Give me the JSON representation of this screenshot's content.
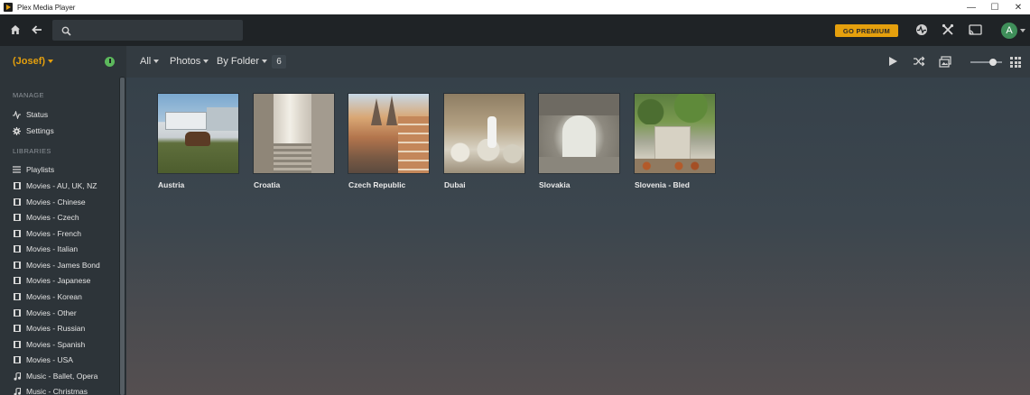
{
  "window": {
    "title": "Plex Media Player",
    "controls": [
      "—",
      "☐",
      "✕"
    ]
  },
  "topbar": {
    "search": {
      "placeholder": "",
      "value": ""
    },
    "premium_label": "GO PREMIUM",
    "avatar_letter": "A"
  },
  "subbar": {
    "user": "(Josef)",
    "filter_all": "All",
    "filter_type": "Photos",
    "filter_sort": "By Folder",
    "count": "6"
  },
  "sidebar": {
    "manage_header": "MANAGE",
    "manage": [
      {
        "label": "Status",
        "icon": "pulse-icon"
      },
      {
        "label": "Settings",
        "icon": "gear-icon"
      }
    ],
    "libraries_header": "LIBRARIES",
    "libraries": [
      {
        "label": "Playlists",
        "icon": "list-icon"
      },
      {
        "label": "Movies - AU, UK, NZ",
        "icon": "film-icon"
      },
      {
        "label": "Movies - Chinese",
        "icon": "film-icon"
      },
      {
        "label": "Movies - Czech",
        "icon": "film-icon"
      },
      {
        "label": "Movies - French",
        "icon": "film-icon"
      },
      {
        "label": "Movies - Italian",
        "icon": "film-icon"
      },
      {
        "label": "Movies - James Bond",
        "icon": "film-icon"
      },
      {
        "label": "Movies - Japanese",
        "icon": "film-icon"
      },
      {
        "label": "Movies - Korean",
        "icon": "film-icon"
      },
      {
        "label": "Movies - Other",
        "icon": "film-icon"
      },
      {
        "label": "Movies - Russian",
        "icon": "film-icon"
      },
      {
        "label": "Movies - Spanish",
        "icon": "film-icon"
      },
      {
        "label": "Movies - USA",
        "icon": "film-icon"
      },
      {
        "label": "Music - Ballet, Opera",
        "icon": "music-icon"
      },
      {
        "label": "Music - Christmas",
        "icon": "music-icon"
      }
    ]
  },
  "folders": [
    {
      "label": "Austria"
    },
    {
      "label": "Croatia"
    },
    {
      "label": "Czech Republic"
    },
    {
      "label": "Dubai"
    },
    {
      "label": "Slovakia"
    },
    {
      "label": "Slovenia - Bled"
    }
  ],
  "colors": {
    "accent": "#e5a00d",
    "topbar": "#1f2326",
    "sidebar": "#2d3439"
  }
}
